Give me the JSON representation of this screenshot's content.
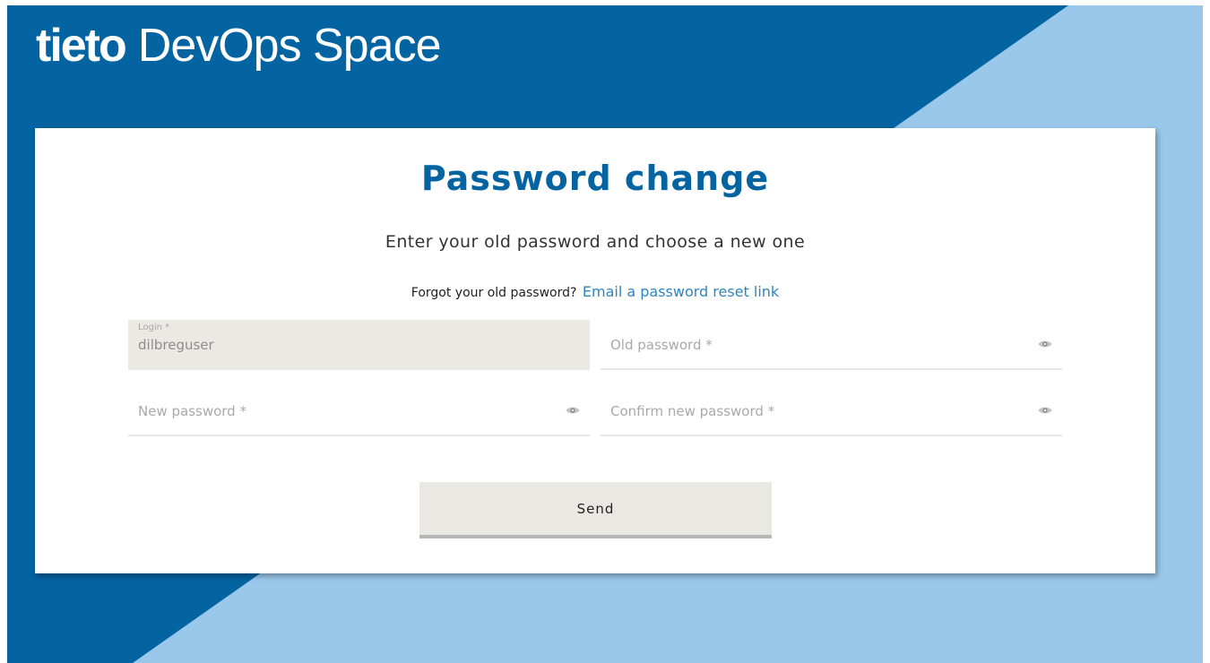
{
  "brand": {
    "logo_word": "tieto",
    "product_name": "DevOps Space"
  },
  "colors": {
    "dark_blue": "#0463a1",
    "light_blue": "#99c8ea",
    "link_blue": "#2e86c1",
    "field_gray": "#eae9e4",
    "button_gray": "#e9e8e3"
  },
  "form": {
    "title": "Password change",
    "subtitle": "Enter your old password and choose a new one",
    "forgot_text": "Forgot your old password?",
    "forgot_link": "Email a password reset link",
    "login": {
      "label": "Login *",
      "value": "dilbreguser"
    },
    "old_password": {
      "placeholder": "Old password *",
      "icon": "eye-icon"
    },
    "new_password": {
      "placeholder": "New password *",
      "icon": "eye-icon"
    },
    "confirm_password": {
      "placeholder": "Confirm new password *",
      "icon": "eye-icon"
    },
    "send_label": "Send"
  }
}
